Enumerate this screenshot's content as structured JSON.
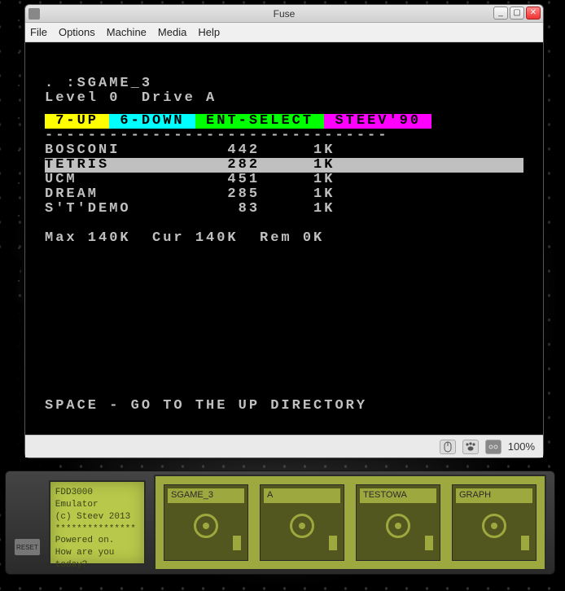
{
  "window": {
    "title": "Fuse",
    "menu": [
      "File",
      "Options",
      "Machine",
      "Media",
      "Help"
    ]
  },
  "screen": {
    "path_line": ". :SGAME_3",
    "status_line": "Level 0  Drive A",
    "header": {
      "seg1": " 7-UP ",
      "seg2": " 6-DOWN ",
      "seg3": " ENT-SELECT ",
      "seg4": " STEEV'90 "
    },
    "dashline": "--------------------------------",
    "files": [
      {
        "name": "BOSCONI",
        "blocks": "442",
        "size": "1K",
        "selected": false
      },
      {
        "name": "TETRIS",
        "blocks": "282",
        "size": "1K",
        "selected": true
      },
      {
        "name": "UCM",
        "blocks": "451",
        "size": "1K",
        "selected": false
      },
      {
        "name": "DREAM",
        "blocks": "285",
        "size": "1K",
        "selected": false
      },
      {
        "name": "S'T'DEMO",
        "blocks": "83",
        "size": "1K",
        "selected": false
      }
    ],
    "footer_stats": "Max 140K  Cur 140K  Rem 0K",
    "hint": "SPACE - GO TO THE UP DIRECTORY"
  },
  "statusbar": {
    "zoom": "100%"
  },
  "fdd": {
    "lcd": {
      "line1": "FDD3000 Emulator",
      "line2": "(c) Steev 2013",
      "line3": "***************",
      "line4": "Powered on.",
      "line5": "How are you today?"
    },
    "reset_label": "RESET",
    "drives": [
      {
        "label": "SGAME_3"
      },
      {
        "label": "A"
      },
      {
        "label": "TESTOWA"
      },
      {
        "label": "GRAPH"
      }
    ]
  }
}
